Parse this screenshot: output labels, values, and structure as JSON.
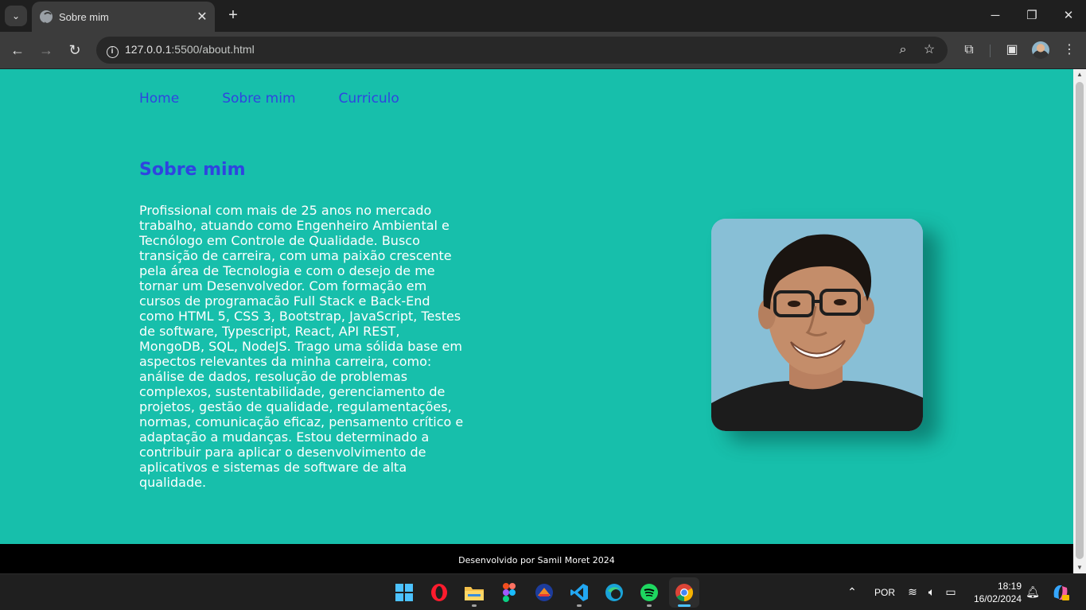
{
  "browser": {
    "tab_title": "Sobre mim",
    "url_host": "127.0.0.1",
    "url_path": ":5500/about.html"
  },
  "site": {
    "nav": [
      {
        "label": "Home"
      },
      {
        "label": "Sobre mim"
      },
      {
        "label": "Curriculo"
      }
    ],
    "heading": "Sobre mim",
    "bio": "Profissional com mais de 25 anos no mercado trabalho, atuando como Engenheiro Ambiental e Tecnólogo em Controle de Qualidade. Busco transição de carreira, com uma paixão crescente pela área de Tecnologia e com o desejo de me tornar um Desenvolvedor. Com formação em cursos de programacão Full Stack e Back-End como HTML 5, CSS 3, Bootstrap, JavaScript, Testes de software, Typescript, React, API REST, MongoDB, SQL, NodeJS. Trago uma sólida base em aspectos relevantes da minha carreira, como: análise de dados, resolução de problemas complexos, sustentabilidade, gerenciamento de projetos, gestão de qualidade, regulamentações, normas, comunicação eficaz, pensamento crítico e adaptação a mudanças. Estou determinado a contribuir para aplicar o desenvolvimento de aplicativos e sistemas de software de alta qualidade.",
    "footer": "Desenvolvido por Samil Moret 2024",
    "colors": {
      "background": "#17bfab",
      "link": "#2f44e0",
      "footer": "#000000"
    }
  },
  "taskbar": {
    "apps": [
      "windows-start-icon",
      "opera-icon",
      "file-explorer-icon",
      "figma-icon",
      "app-icon",
      "vscode-icon",
      "edge-icon",
      "spotify-icon",
      "chrome-icon"
    ],
    "language": "POR",
    "time": "18:19",
    "date": "16/02/2024"
  }
}
